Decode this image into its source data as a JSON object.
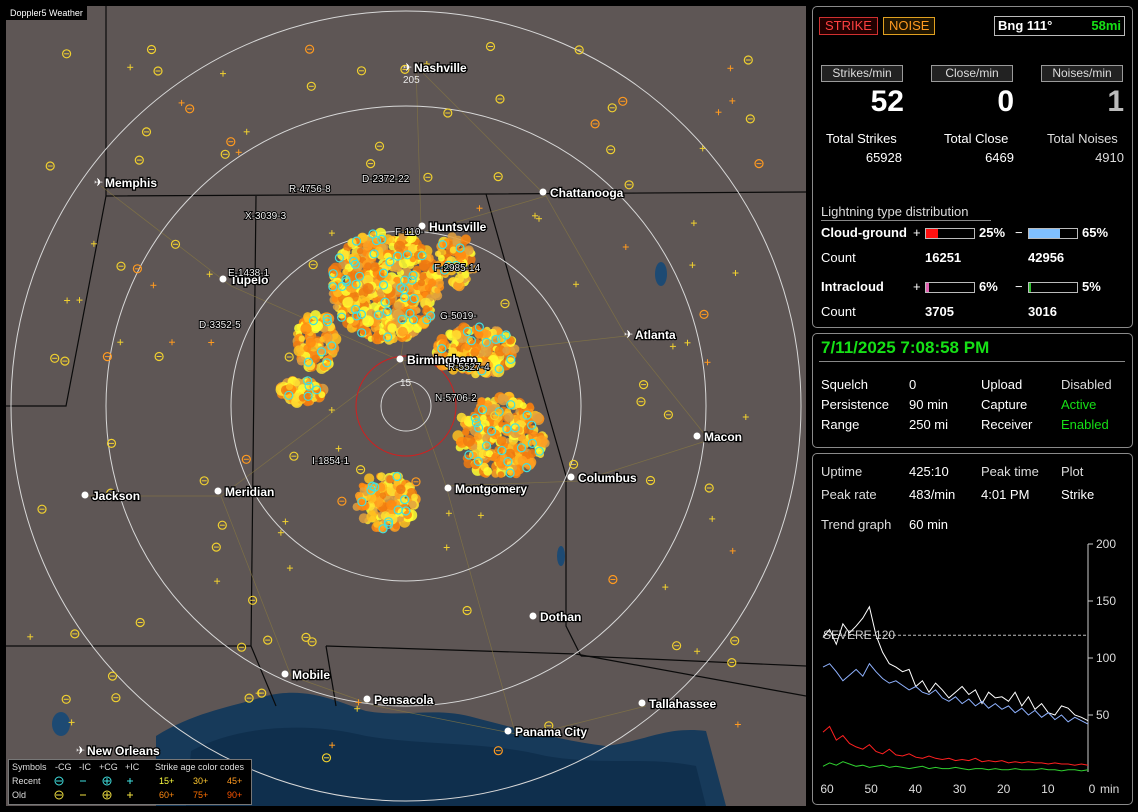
{
  "window_title": "Doppler5 Weather",
  "map": {
    "cities": [
      {
        "name": "Nashville",
        "plane": true
      },
      {
        "name": "Memphis",
        "plane": true
      },
      {
        "name": "Chattanooga",
        "plane": false
      },
      {
        "name": "Huntsville",
        "plane": false
      },
      {
        "name": "Tupelo",
        "plane": false
      },
      {
        "name": "Birmingham",
        "plane": false
      },
      {
        "name": "Atlanta",
        "plane": true
      },
      {
        "name": "Macon",
        "plane": false
      },
      {
        "name": "Columbus",
        "plane": false
      },
      {
        "name": "Montgomery",
        "plane": false
      },
      {
        "name": "Meridian",
        "plane": false
      },
      {
        "name": "Jackson",
        "plane": false
      },
      {
        "name": "Dothan",
        "plane": false
      },
      {
        "name": "Mobile",
        "plane": false
      },
      {
        "name": "Pensacola",
        "plane": false
      },
      {
        "name": "Tallahassee",
        "plane": false
      },
      {
        "name": "Panama City",
        "plane": false
      },
      {
        "name": "New Orleans",
        "plane": true
      }
    ],
    "storm_labels": [
      "R-4756-8",
      "D-2372-22",
      "X-3039-3",
      "E-1438-1",
      "D-3352-5",
      "F-110-",
      "F-2985-14",
      "G-5019-",
      "R-5527-4",
      "N-5706-2",
      "I-1854-1"
    ],
    "range_labels": [
      "205",
      "15"
    ]
  },
  "legend": {
    "title": "Symbols",
    "cols": [
      "-CG",
      "-IC",
      "+CG",
      "+IC"
    ],
    "row_labels": [
      "Recent",
      "Old"
    ],
    "age_title": "Strike age color codes",
    "ages": [
      [
        "15+",
        "30+",
        "45+"
      ],
      [
        "60+",
        "75+",
        "90+"
      ]
    ],
    "age_colors": [
      "#ffff40",
      "#ffc830",
      "#ff9a20",
      "#ff8a10",
      "#ff7000",
      "#ff5500"
    ]
  },
  "status": {
    "strike_label": "STRIKE",
    "noise_label": "NOISE",
    "bearing_label": "Bng 111°",
    "distance": "58mi"
  },
  "stats": {
    "strikes_header": "Strikes/min",
    "close_header": "Close/min",
    "noises_header": "Noises/min",
    "strikes_per_min": "52",
    "close_per_min": "0",
    "noises_per_min": "1",
    "total_strikes_label": "Total Strikes",
    "total_close_label": "Total Close",
    "total_noises_label": "Total Noises",
    "total_strikes": "65928",
    "total_close": "6469",
    "total_noises": "4910"
  },
  "distribution": {
    "title": "Lightning type distribution",
    "cg_label": "Cloud-ground",
    "ic_label": "Intracloud",
    "count_label": "Count",
    "plus": "+",
    "minus": "−",
    "cg_pos_pct": "25%",
    "cg_neg_pct": "65%",
    "cg_pos_count": "16251",
    "cg_neg_count": "42956",
    "ic_pos_pct": "6%",
    "ic_neg_pct": "5%",
    "ic_pos_count": "3705",
    "ic_neg_count": "3016",
    "cg_pos_fill": 0.25,
    "cg_neg_fill": 0.65,
    "ic_pos_fill": 0.06,
    "ic_neg_fill": 0.05
  },
  "system": {
    "datetime": "7/11/2025 7:08:58 PM",
    "squelch_label": "Squelch",
    "squelch": "0",
    "persistence_label": "Persistence",
    "persistence": "90 min",
    "range_label": "Range",
    "range": "250 mi",
    "upload_label": "Upload",
    "upload": "Disabled",
    "capture_label": "Capture",
    "capture": "Active",
    "receiver_label": "Receiver",
    "receiver": "Enabled"
  },
  "uptime": {
    "uptime_label": "Uptime",
    "uptime": "425:10",
    "peak_time_label": "Peak time",
    "peak_time": "4:01 PM",
    "plot_label": "Plot",
    "peak_rate_label": "Peak rate",
    "peak_rate": "483/min",
    "plot": "Strike",
    "trend_label": "Trend graph",
    "trend": "60 min"
  },
  "chart_data": {
    "type": "line",
    "x_unit": "min",
    "xticks": [
      60,
      50,
      40,
      30,
      20,
      10,
      0
    ],
    "yticks": [
      50,
      100,
      150,
      200
    ],
    "ylim": [
      0,
      200
    ],
    "severe_label": "SEVERE 120",
    "severe_value": 120,
    "series": [
      {
        "color": "#ffffff",
        "values": [
          118,
          125,
          112,
          130,
          122,
          128,
          135,
          145,
          120,
          105,
          95,
          92,
          88,
          90,
          75,
          80,
          70,
          78,
          72,
          65,
          70,
          75,
          68,
          72,
          60,
          70,
          65,
          66,
          62,
          70,
          58,
          66,
          55,
          60,
          52,
          50,
          58,
          56,
          50,
          48,
          45
        ]
      },
      {
        "color": "#8fb2ff",
        "values": [
          92,
          95,
          88,
          80,
          85,
          90,
          84,
          95,
          88,
          82,
          78,
          80,
          76,
          72,
          75,
          70,
          68,
          72,
          65,
          62,
          66,
          60,
          64,
          58,
          62,
          56,
          60,
          55,
          58,
          52,
          56,
          50,
          54,
          48,
          52,
          46,
          50,
          44,
          48,
          45,
          42
        ]
      },
      {
        "color": "#ff2020",
        "values": [
          35,
          40,
          28,
          32,
          25,
          22,
          20,
          24,
          18,
          16,
          20,
          15,
          14,
          16,
          13,
          12,
          14,
          12,
          11,
          12,
          10,
          11,
          10,
          12,
          9,
          10,
          9,
          10,
          8,
          9,
          8,
          9,
          8,
          8,
          7,
          8,
          7,
          7,
          6,
          7,
          6
        ]
      },
      {
        "color": "#30d030",
        "values": [
          5,
          8,
          6,
          9,
          7,
          5,
          6,
          4,
          5,
          6,
          4,
          5,
          4,
          3,
          4,
          5,
          3,
          4,
          3,
          3,
          4,
          3,
          2,
          3,
          3,
          2,
          3,
          2,
          2,
          3,
          2,
          2,
          2,
          3,
          2,
          2,
          1,
          2,
          2,
          1,
          2
        ]
      }
    ]
  }
}
